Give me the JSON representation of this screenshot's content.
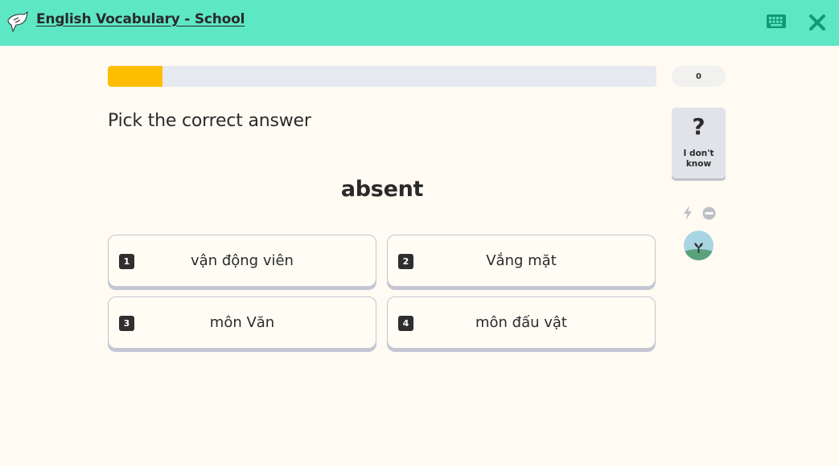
{
  "header": {
    "title": "English Vocabulary - School",
    "logo_icon": "memrise-logo-icon",
    "keyboard_icon": "keyboard-icon",
    "close_icon": "close-icon",
    "bar_color": "#5ee7c4"
  },
  "session": {
    "progress_fraction": 0.1,
    "score": "0",
    "progress_color": "#ffbd00"
  },
  "question": {
    "prompt": "Pick the correct answer",
    "word": "absent"
  },
  "answers": [
    {
      "number": "1",
      "text": "vận động viên"
    },
    {
      "number": "2",
      "text": "Vắng mặt"
    },
    {
      "number": "3",
      "text": "môn Văn"
    },
    {
      "number": "4",
      "text": "môn đấu vật"
    }
  ],
  "sidebar": {
    "dont_know_icon": "question-mark-icon",
    "dont_know_symbol": "?",
    "dont_know_label": "I don't know",
    "bolt_icon": "lightning-bolt-icon",
    "minus_icon": "no-entry-icon",
    "avatar_icon": "sprout-avatar-icon"
  }
}
